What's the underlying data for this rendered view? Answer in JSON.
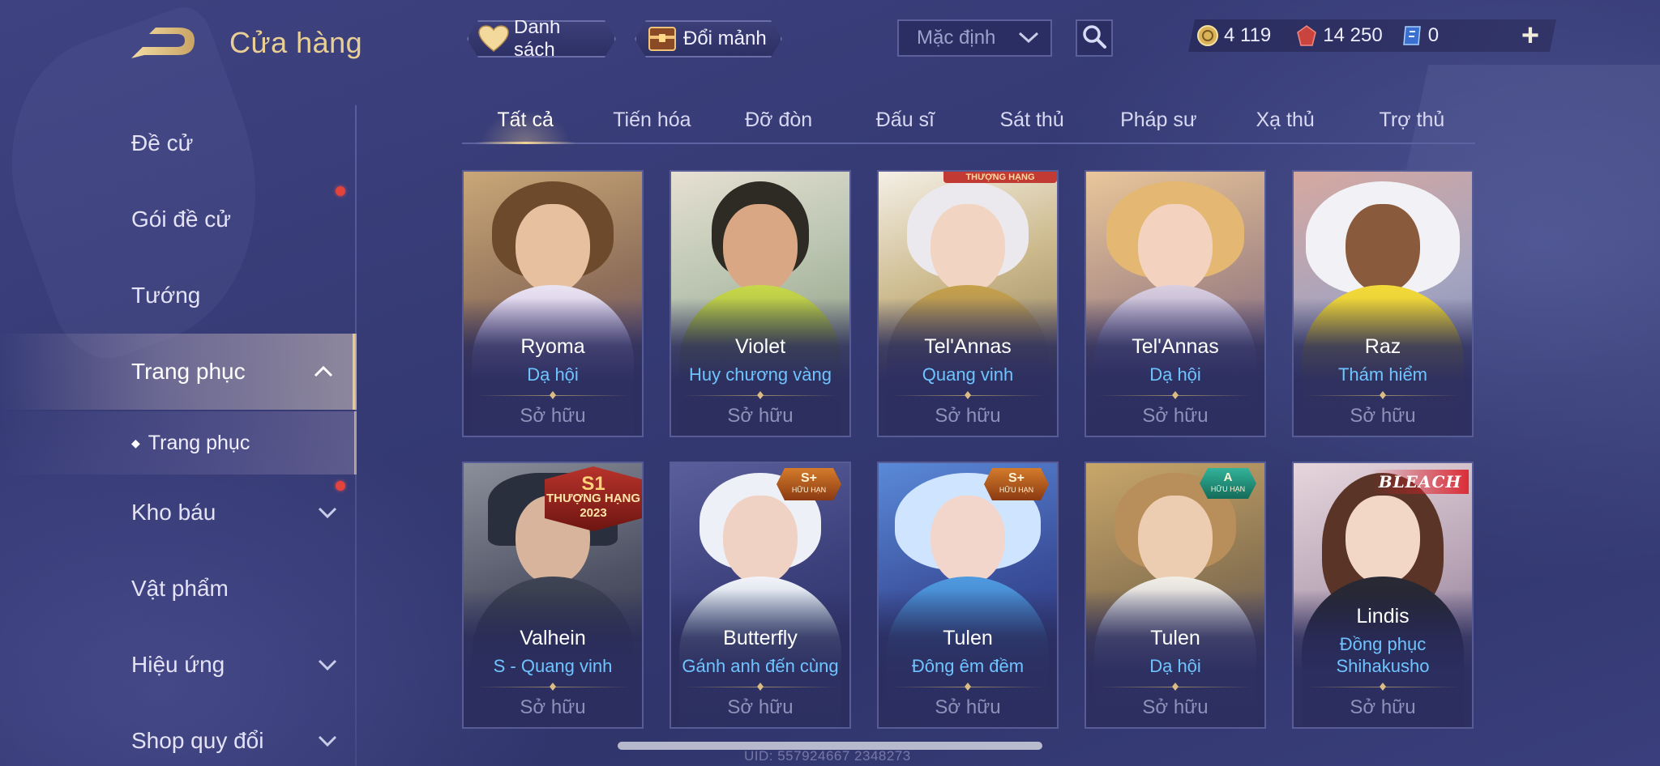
{
  "header": {
    "title": "Cửa hàng",
    "list_button": "Danh sách",
    "exchange_button": "Đổi mảnh",
    "sort_value": "Mặc định",
    "currencies": [
      {
        "icon": "gold-coin-icon",
        "value": "4 119"
      },
      {
        "icon": "red-gem-icon",
        "value": "14 250"
      },
      {
        "icon": "blue-voucher-icon",
        "value": "0"
      }
    ]
  },
  "sidebar": {
    "items": [
      {
        "label": "Đề cử"
      },
      {
        "label": "Gói đề cử"
      },
      {
        "label": "Tướng"
      },
      {
        "label": "Trang phục"
      },
      {
        "label": "Kho báu"
      },
      {
        "label": "Vật phẩm"
      },
      {
        "label": "Hiệu ứng"
      },
      {
        "label": "Shop quy đổi"
      }
    ],
    "sub_item": "Trang phục"
  },
  "tabs": [
    "Tất cả",
    "Tiến hóa",
    "Đỡ đòn",
    "Đấu sĩ",
    "Sát thủ",
    "Pháp sư",
    "Xạ thủ",
    "Trợ thủ"
  ],
  "cards": [
    {
      "hero": "Ryoma",
      "skin": "Dạ hội",
      "status": "Sở hữu"
    },
    {
      "hero": "Violet",
      "skin": "Huy chương vàng",
      "status": "Sở hữu"
    },
    {
      "hero": "Tel'Annas",
      "skin": "Quang vinh",
      "status": "Sở hữu",
      "badge_text": "THƯỢNG HẠNG"
    },
    {
      "hero": "Tel'Annas",
      "skin": "Dạ hội",
      "status": "Sở hữu"
    },
    {
      "hero": "Raz",
      "skin": "Thám hiểm",
      "status": "Sở hữu"
    },
    {
      "hero": "Valhein",
      "skin": "S - Quang vinh",
      "status": "Sở hữu",
      "badge_top": "S1",
      "badge_mid": "THƯỢNG HẠNG",
      "badge_bottom": "2023"
    },
    {
      "hero": "Butterfly",
      "skin": "Gánh anh đến cùng",
      "status": "Sở hữu",
      "badge_top": "S+",
      "badge_bottom": "HỮU HẠN"
    },
    {
      "hero": "Tulen",
      "skin": "Đông êm đềm",
      "status": "Sở hữu",
      "badge_top": "S+",
      "badge_bottom": "HỮU HẠN"
    },
    {
      "hero": "Tulen",
      "skin": "Dạ hội",
      "status": "Sở hữu",
      "badge_top": "A",
      "badge_bottom": "HỮU HẠN"
    },
    {
      "hero": "Lindis",
      "skin": "Đồng phục Shihakusho",
      "status": "Sở hữu",
      "badge_top": "BLEACH"
    }
  ],
  "footer": {
    "uid": "UID: 557924667 2348273"
  },
  "colors": {
    "accent_gold": "#e9cf95",
    "skin_blue": "#6fc4ff",
    "notification_red": "#e2433b"
  }
}
